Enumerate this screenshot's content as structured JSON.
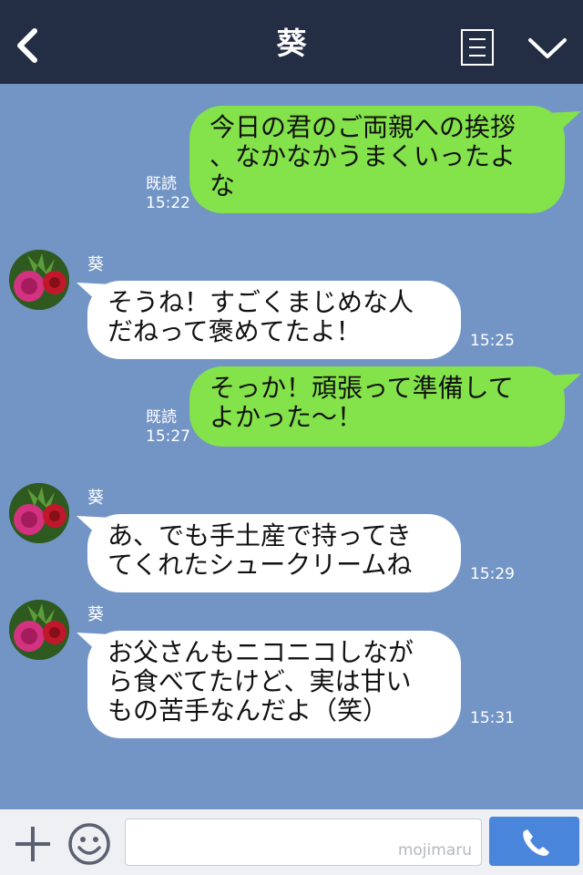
{
  "header": {
    "title": "葵",
    "back_icon": "chevron-left-icon",
    "menu_icon": "list-icon",
    "collapse_icon": "chevron-down-icon"
  },
  "messages": [
    {
      "side": "out",
      "lines": [
        "今日の君のご両親への挨拶",
        "、なかなかうまくいったよ",
        "な"
      ],
      "read": "既読",
      "time": "15:22"
    },
    {
      "side": "in",
      "sender": "葵",
      "lines": [
        "そうね！すごくまじめな人",
        "だねって褒めてたよ！"
      ],
      "time": "15:25"
    },
    {
      "side": "out",
      "lines": [
        "そっか！頑張って準備して",
        "よかった〜！"
      ],
      "read": "既読",
      "time": "15:27"
    },
    {
      "side": "in",
      "sender": "葵",
      "lines": [
        "あ、でも手土産で持ってき",
        "てくれたシュークリームね"
      ],
      "time": "15:29"
    },
    {
      "side": "in",
      "sender": "葵",
      "lines": [
        "お父さんもニコニコしなが",
        "ら食べてたけど、実は甘い",
        "もの苦手なんだよ（笑）"
      ],
      "time": "15:31"
    }
  ],
  "footer": {
    "plus_icon": "plus-icon",
    "emoji_icon": "smiley-icon",
    "watermark": "mojimaru",
    "call_icon": "phone-icon"
  },
  "colors": {
    "background": "#7395c6",
    "header": "#232d44",
    "outgoing_bubble": "#84e24a",
    "incoming_bubble": "#ffffff",
    "call_button": "#4a85dc"
  }
}
